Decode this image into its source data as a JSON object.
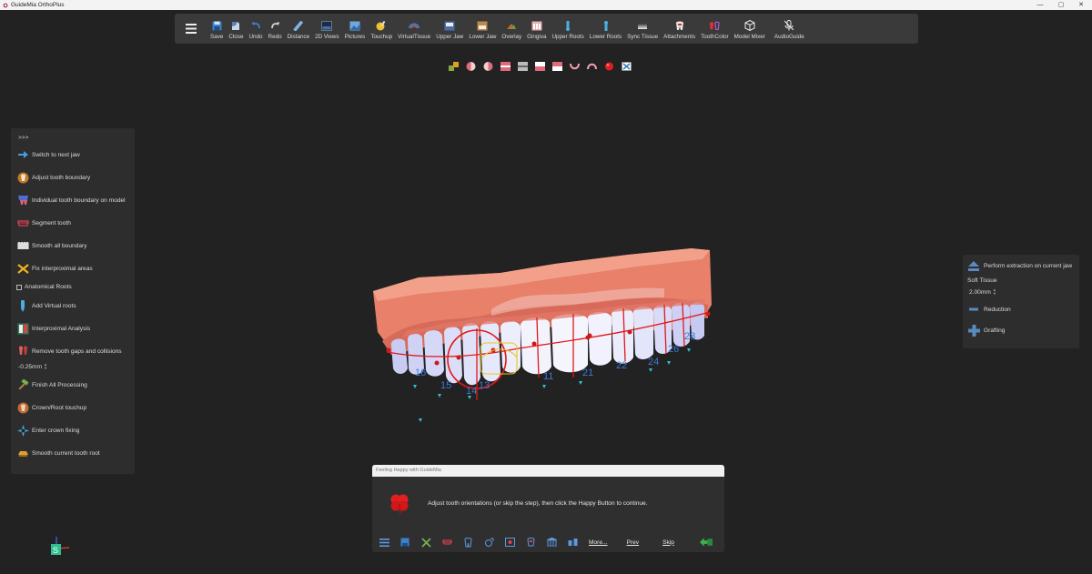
{
  "window": {
    "title": "GuideMia OrthoPlus",
    "controls": {
      "minimize": "—",
      "maximize": "▢",
      "close": "✕"
    }
  },
  "toolbar": {
    "buttons": [
      {
        "label": "Save",
        "icon": "save-icon"
      },
      {
        "label": "Close",
        "icon": "close-file-icon"
      },
      {
        "label": "Undo",
        "icon": "undo-icon"
      },
      {
        "label": "Redo",
        "icon": "redo-icon"
      },
      {
        "label": "Distance",
        "icon": "ruler-icon"
      },
      {
        "label": "2D Views",
        "icon": "2d-views-icon"
      },
      {
        "label": "Pictures",
        "icon": "pictures-icon"
      },
      {
        "label": "Touchup",
        "icon": "touchup-icon"
      },
      {
        "label": "VirtualTissue",
        "icon": "virtual-tissue-icon"
      },
      {
        "label": "Upper Jaw",
        "icon": "upper-jaw-icon"
      },
      {
        "label": "Lower Jaw",
        "icon": "lower-jaw-icon"
      },
      {
        "label": "Overlay",
        "icon": "overlay-icon"
      },
      {
        "label": "Gingiva",
        "icon": "gingiva-icon"
      },
      {
        "label": "Upper Roots",
        "icon": "upper-roots-icon"
      },
      {
        "label": "Lower Roots",
        "icon": "lower-roots-icon"
      },
      {
        "label": "Sync Tissue",
        "icon": "sync-tissue-icon"
      },
      {
        "label": "Attachments",
        "icon": "attachments-icon"
      },
      {
        "label": "ToothColor",
        "icon": "tooth-color-icon"
      },
      {
        "label": "Model Mixer",
        "icon": "model-mixer-icon"
      },
      {
        "label": "AudioGuide",
        "icon": "audio-guide-icon"
      }
    ]
  },
  "left_panel": {
    "expand_label": ">>>",
    "items": [
      {
        "label": "Switch to next jaw",
        "icon": "arrow-right-icon"
      },
      {
        "label": "Adjust tooth boundary",
        "icon": "tooth-boundary-icon"
      },
      {
        "label": "Individual tooth boundary on model",
        "icon": "model-boundary-icon"
      },
      {
        "label": "Segment tooth",
        "icon": "segment-tooth-icon"
      },
      {
        "label": "Smooth all boundary",
        "icon": "smooth-boundary-icon"
      },
      {
        "label": "Fix interproximal areas",
        "icon": "fix-interproximal-icon"
      }
    ],
    "checkbox": {
      "label": "Anatomical Roots",
      "checked": false
    },
    "items2": [
      {
        "label": "Add Virtual roots",
        "icon": "virtual-root-icon"
      },
      {
        "label": "Interproximal Analysis",
        "icon": "interproximal-analysis-icon"
      },
      {
        "label": "Remove tooth gaps and collisions",
        "icon": "remove-gaps-icon"
      }
    ],
    "gap_value": "-0.25mm",
    "items3": [
      {
        "label": "Finish All Processing",
        "icon": "hammer-icon"
      },
      {
        "label": "Crown/Root touchup",
        "icon": "crown-touchup-icon"
      },
      {
        "label": "Enter crown fixing",
        "icon": "crown-fixing-icon"
      },
      {
        "label": "Smooth current tooth root",
        "icon": "smooth-root-icon"
      }
    ]
  },
  "right_panel": {
    "extraction_label": "Perform extraction on current jaw",
    "soft_tissue_label": "Soft Tissue",
    "soft_tissue_value": "2.00mm",
    "reduction_label": "Reduction",
    "grafting_label": "Grafting"
  },
  "model": {
    "tooth_numbers": [
      "11",
      "12",
      "13",
      "14",
      "15",
      "16",
      "21",
      "22",
      "24",
      "26",
      "28"
    ]
  },
  "dialog": {
    "title": "Feeling Happy with GuideMia",
    "message": "Adjust tooth orientations (or skip the step), then click the Happy Button to continue.",
    "more_label": "More...",
    "prev_label": "Prev",
    "skip_label": "Skip"
  },
  "colors": {
    "background": "#222222",
    "panel": "#2d2d2d",
    "toolbar": "#3a3a3a",
    "gingiva": "#e8806a",
    "tooth": "#e9eaf5",
    "annotation_red": "#e01818",
    "annotation_blue": "#2f72c8"
  }
}
